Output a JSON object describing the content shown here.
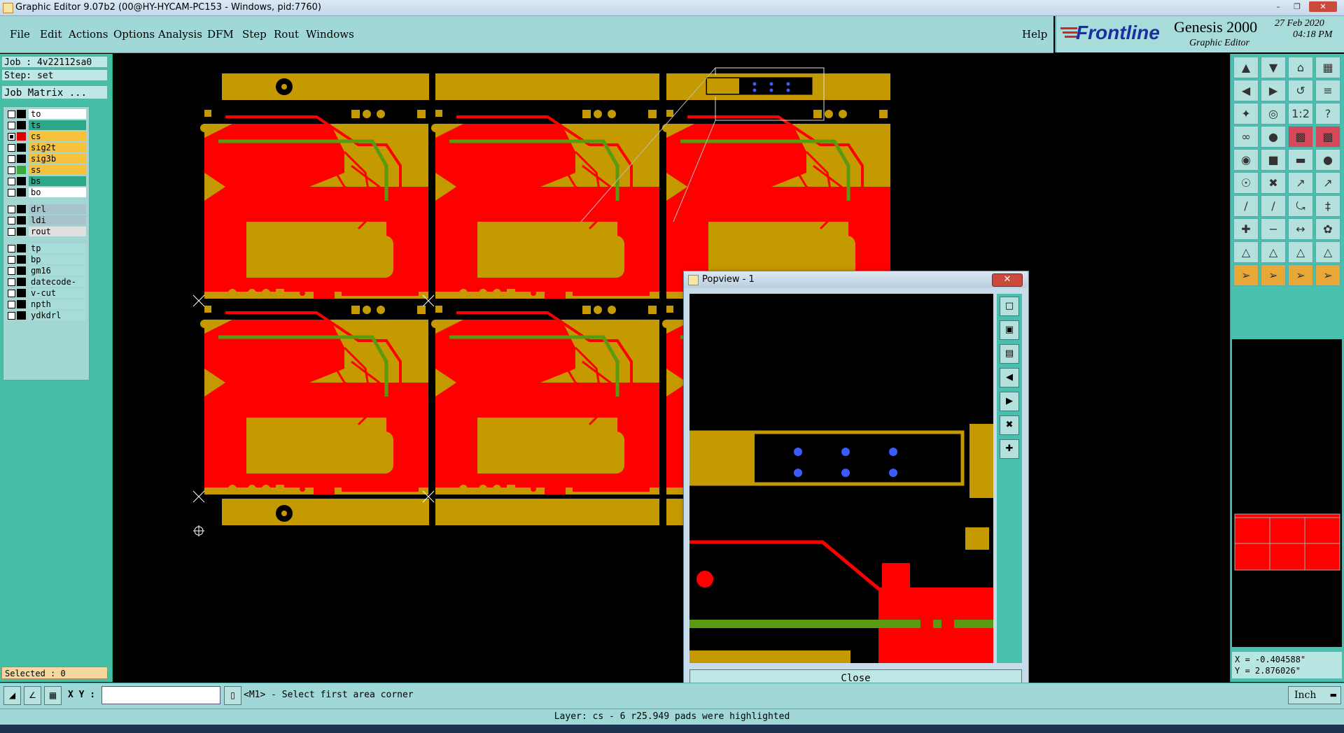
{
  "window": {
    "title": "Graphic Editor 9.07b2 (00@HY-HYCAM-PC153 - Windows, pid:7760)"
  },
  "menu": {
    "items": [
      "File",
      "Edit",
      "Actions",
      "Options",
      "Analysis",
      "DFM",
      "Step",
      "Rout",
      "Windows"
    ],
    "help": "Help"
  },
  "logo": {
    "brand": "Frontline",
    "product": "Genesis 2000",
    "subtitle": "Graphic Editor",
    "date": "27 Feb 2020",
    "time": "04:18 PM"
  },
  "job": {
    "job_label": "Job : 4v22112sa0",
    "step_label": "Step: set",
    "matrix_button": "Job Matrix ..."
  },
  "layers": [
    {
      "name": "to",
      "color": "#ffffff",
      "swatch": "#000000",
      "checked": false
    },
    {
      "name": "ts",
      "color": "#2ca889",
      "swatch": "#000000",
      "checked": false
    },
    {
      "name": "cs",
      "color": "#f5c23d",
      "swatch": "#e00000",
      "checked": true
    },
    {
      "name": "sig2t",
      "color": "#f5c23d",
      "swatch": "#000000",
      "checked": false
    },
    {
      "name": "sig3b",
      "color": "#f5c23d",
      "swatch": "#000000",
      "checked": false
    },
    {
      "name": "ss",
      "color": "#f5c23d",
      "swatch": "#3aa83a",
      "checked": false
    },
    {
      "name": "bs",
      "color": "#2ca889",
      "swatch": "#000000",
      "checked": false
    },
    {
      "name": "bo",
      "color": "#ffffff",
      "swatch": "#000000",
      "checked": false
    },
    {
      "name": "drl",
      "color": "#a7c3cc",
      "swatch": "#000000",
      "checked": false
    },
    {
      "name": "ldi",
      "color": "#a7c3cc",
      "swatch": "#000000",
      "checked": false
    },
    {
      "name": "rout",
      "color": "#e0e0e0",
      "swatch": "#000000",
      "checked": false
    },
    {
      "name": "tp",
      "color": "#a8dcd8",
      "swatch": "#000000",
      "checked": false
    },
    {
      "name": "bp",
      "color": "#a8dcd8",
      "swatch": "#000000",
      "checked": false
    },
    {
      "name": "gm16",
      "color": "#a8dcd8",
      "swatch": "#000000",
      "checked": false
    },
    {
      "name": "datecode-bs",
      "color": "#a8dcd8",
      "swatch": "#000000",
      "checked": false
    },
    {
      "name": "v-cut",
      "color": "#a8dcd8",
      "swatch": "#000000",
      "checked": false
    },
    {
      "name": "npth",
      "color": "#a8dcd8",
      "swatch": "#000000",
      "checked": false
    },
    {
      "name": "ydkdrl",
      "color": "#a8dcd8",
      "swatch": "#000000",
      "checked": false
    }
  ],
  "selected": "Selected : 0",
  "coords": {
    "x": "X = -0.404588\"",
    "y": "Y = 2.876026\""
  },
  "bottom": {
    "xy_label": "X Y :",
    "xy_value": "",
    "prompt": "<M1> - Select first area corner",
    "unit": "Inch"
  },
  "status": "Layer: cs - 6 r25.949 pads were highlighted",
  "popview": {
    "title": "Popview - 1",
    "close_button": "Close"
  },
  "colors": {
    "copper_red": "#ff0000",
    "copper_gold": "#c59a00",
    "trace_green": "#5a9a10",
    "pad_blue": "#3a5cff",
    "panel_teal": "#45c0a7"
  }
}
